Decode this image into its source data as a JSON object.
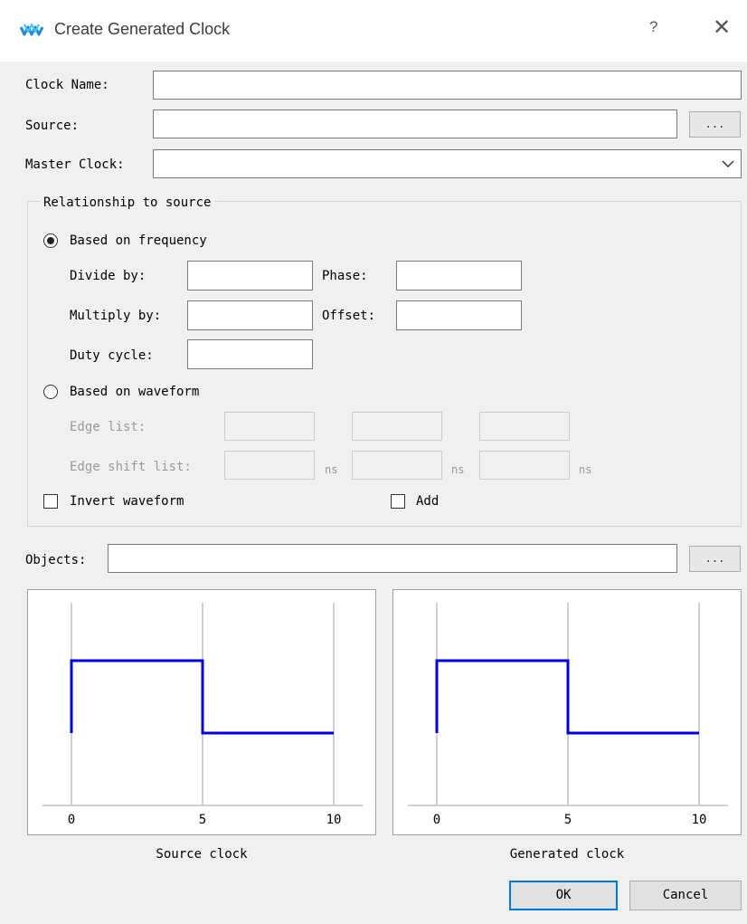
{
  "window": {
    "title": "Create Generated Clock",
    "help_label": "?",
    "close_label": "✕",
    "logo_icon": "gowin-logo-icon"
  },
  "form": {
    "clock_name_label": "Clock Name:",
    "source_label": "Source:",
    "master_clock_label": "Master Clock:",
    "browse_label": "...",
    "objects_label": "Objects:"
  },
  "relationship": {
    "title": "Relationship to source",
    "freq_label": "Based on frequency",
    "freq_selected": true,
    "divide_by_label": "Divide by:",
    "phase_label": "Phase:",
    "multiply_by_label": "Multiply by:",
    "offset_label": "Offset:",
    "duty_cycle_label": "Duty cycle:",
    "waveform_label": "Based on waveform",
    "edge_list_label": "Edge list:",
    "edge_shift_label": "Edge shift list:",
    "ns_unit": "ns",
    "invert_label": "Invert waveform",
    "add_label": "Add"
  },
  "chart_data": [
    {
      "type": "line",
      "title": "Source clock",
      "x": [
        0,
        0,
        5,
        5,
        10
      ],
      "y": [
        0,
        1,
        1,
        0,
        0
      ],
      "xticks": [
        "0",
        "5",
        "10"
      ],
      "xlim": [
        0,
        10
      ],
      "ylim": [
        -1,
        1.5
      ],
      "grid": true,
      "color": "#0000dd"
    },
    {
      "type": "line",
      "title": "Generated clock",
      "x": [
        0,
        0,
        5,
        5,
        10
      ],
      "y": [
        0,
        1,
        1,
        0,
        0
      ],
      "xticks": [
        "0",
        "5",
        "10"
      ],
      "xlim": [
        0,
        10
      ],
      "ylim": [
        -1,
        1.5
      ],
      "grid": true,
      "color": "#0000dd"
    }
  ],
  "buttons": {
    "ok_label": "OK",
    "cancel_label": "Cancel"
  }
}
